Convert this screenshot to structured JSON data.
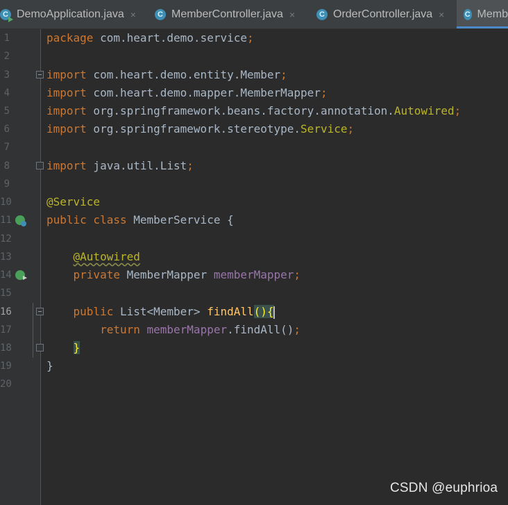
{
  "tabs": [
    {
      "label": "DemoApplication.java",
      "icon": "run-class-icon",
      "active": false,
      "close": "×"
    },
    {
      "label": "MemberController.java",
      "icon": "class-icon",
      "active": false,
      "close": "×"
    },
    {
      "label": "OrderController.java",
      "icon": "class-icon",
      "active": false,
      "close": "×"
    },
    {
      "label": "Memb",
      "icon": "class-icon",
      "active": true
    }
  ],
  "tab_icon_letter": "C",
  "editor": {
    "line_numbers": [
      "1",
      "2",
      "3",
      "4",
      "5",
      "6",
      "7",
      "8",
      "9",
      "10",
      "11",
      "12",
      "13",
      "14",
      "15",
      "16",
      "17",
      "18",
      "19",
      "20"
    ],
    "current_line": "16",
    "l1": {
      "kw": "package",
      "pkg": " com.heart.demo.service",
      "semi": ";"
    },
    "l3": {
      "kw": "import",
      "pkg": " com.heart.demo.entity.Member",
      "semi": ";"
    },
    "l4": {
      "kw": "import",
      "pkg": " com.heart.demo.mapper.MemberMapper",
      "semi": ";"
    },
    "l5": {
      "kw": "import",
      "pkg": " org.springframework.beans.factory.annotation.",
      "cls": "Autowired",
      "semi": ";"
    },
    "l6": {
      "kw": "import",
      "pkg": " org.springframework.stereotype.",
      "cls": "Service",
      "semi": ";"
    },
    "l8": {
      "kw": "import",
      "pkg": " java.util.List",
      "semi": ";"
    },
    "l10": {
      "ann": "@Service"
    },
    "l11": {
      "kw": "public class",
      "rest": " MemberService {"
    },
    "l13": {
      "ann": "@Autowired"
    },
    "l14": {
      "kw": "private",
      "type": " MemberMapper ",
      "field": "memberMapper",
      "semi": ";"
    },
    "l16": {
      "kw": "public",
      "type": " List<Member> ",
      "fn": "findAll",
      "paren": "()",
      "brace": "{"
    },
    "l17": {
      "kw": "return",
      "space": " ",
      "field": "memberMapper",
      "call": ".findAll()",
      "semi": ";"
    },
    "l18": {
      "brace": "}"
    },
    "l19": {
      "brace": "}"
    }
  },
  "watermark": "CSDN @euphrioa",
  "colors": {
    "keyword": "#cc7832",
    "annotation": "#bbb529",
    "field": "#9876aa",
    "method": "#ffc66d",
    "text": "#a9b7c6",
    "background": "#2b2b2b"
  }
}
